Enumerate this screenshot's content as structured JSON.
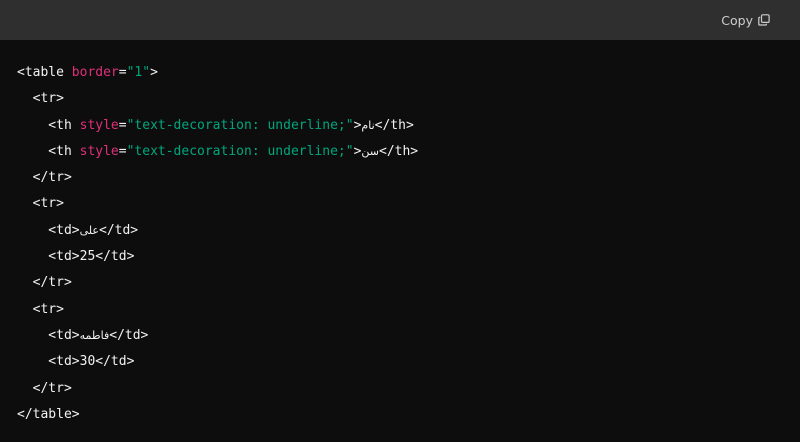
{
  "header": {
    "copy_label": "Copy",
    "copy_icon": "copy-icon"
  },
  "colors": {
    "header_bg": "#2f2f2f",
    "code_bg": "#0d0d0d",
    "tag_text": "#f2f2f2",
    "attr_name": "#df3079",
    "attr_value": "#00a67d"
  },
  "code": {
    "l1": {
      "open": "<table ",
      "attr": "border",
      "eq": "=",
      "val": "\"1\"",
      "close": ">"
    },
    "l2": {
      "text": "  <tr>"
    },
    "l3": {
      "open": "    <th ",
      "attr": "style",
      "eq": "=",
      "val": "\"text-decoration: underline;\"",
      "gt": ">",
      "content": "نام",
      "close": "</th>"
    },
    "l4": {
      "open": "    <th ",
      "attr": "style",
      "eq": "=",
      "val": "\"text-decoration: underline;\"",
      "gt": ">",
      "content": "سن",
      "close": "</th>"
    },
    "l5": {
      "text": "  </tr>"
    },
    "l6": {
      "text": "  <tr>"
    },
    "l7": {
      "open": "    <td>",
      "content": "علی",
      "close": "</td>"
    },
    "l8": {
      "text": "    <td>25</td>"
    },
    "l9": {
      "text": "  </tr>"
    },
    "l10": {
      "text": "  <tr>"
    },
    "l11": {
      "open": "    <td>",
      "content": "فاطمه",
      "close": "</td>"
    },
    "l12": {
      "text": "    <td>30</td>"
    },
    "l13": {
      "text": "  </tr>"
    },
    "l14": {
      "text": "</table>"
    }
  }
}
